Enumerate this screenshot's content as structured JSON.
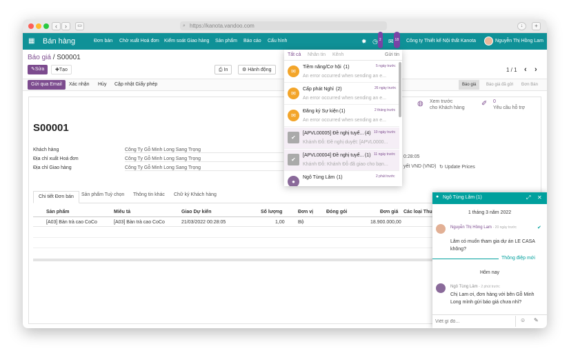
{
  "browser": {
    "url": "https://kanota.vandoo.com"
  },
  "topbar": {
    "app_name": "Bán hàng",
    "menu": [
      "Đơn bán",
      "Chờ xuất Hoá đơn",
      "Kiểm soát Giao hàng",
      "Sản phẩm",
      "Báo cáo",
      "Cấu hình"
    ],
    "activity_count": "2",
    "message_count": "18",
    "company": "Công ty Thiết kế Nội thất Kanota",
    "user": "Nguyễn Thị Hồng Lam"
  },
  "breadcrumb": {
    "parent": "Báo giá",
    "sep": "/",
    "current": "S00001"
  },
  "toolbar": {
    "edit": "Sửa",
    "create": "Tạo",
    "print": "In",
    "action": "Hành động",
    "pager": "1 / 1"
  },
  "statusbar": {
    "buttons": [
      "Gửi qua Email",
      "Xác nhận",
      "Hủy",
      "Cập nhật Giấy phép"
    ],
    "stages": [
      "Báo giá",
      "Báo giá đã gửi",
      "Đơn Bán"
    ]
  },
  "smart": {
    "preview": "Xem trước",
    "preview2": "cho Khách hàng",
    "support_count": "0",
    "support": "Yêu cầu hỗ trợ"
  },
  "order": {
    "name": "S00001",
    "customer_label": "Khách hàng",
    "customer": "Công Ty Gỗ Minh Long Sang Trọng",
    "invoice_label": "Địa chỉ xuất Hoá đơn",
    "invoice": "Công Ty Gỗ Minh Long Sang Trọng",
    "delivery_label": "Địa chỉ Giao hàng",
    "delivery": "Công Ty Gỗ Minh Long Sang Trọng",
    "date_fragment": "0:28:05",
    "pricelist_fragment": "yết VND (VND)",
    "update_prices": "Update Prices"
  },
  "tabs": [
    "Chi tiết Đơn bán",
    "Sản phẩm Tuỳ chọn",
    "Thông tin khác",
    "Chữ ký Khách hàng"
  ],
  "lines": {
    "headers": [
      "Sản phẩm",
      "Miêu tả",
      "Giao Dự kiến",
      "Số lượng",
      "Đơn vị",
      "Đóng gói",
      "Đơn giá",
      "Các loại Thuế"
    ],
    "rows": [
      [
        "[A03] Bàn trà cao CoCo",
        "[A03] Bàn trà cao CoCo",
        "21/03/2022 00:28:05",
        "1,00",
        "Bộ",
        "",
        "18.900.000,00",
        ""
      ]
    ]
  },
  "notifications": {
    "tabs": [
      "Tất cả",
      "Nhân tin",
      "Kênh"
    ],
    "mark_read": "Gửi tin",
    "items": [
      {
        "title": "Tiềm năng/Cơ hội",
        "count": "(1)",
        "time": "5 ngày trước",
        "preview": "An error occurred when sending an e..."
      },
      {
        "title": "Cấp phát Nghỉ",
        "count": "(2)",
        "time": "26 ngày trước",
        "preview": "An error occurred when sending an e..."
      },
      {
        "title": "Đăng ký Sự kiện",
        "count": "(1)",
        "time": "2 tháng trước",
        "preview": "An error occurred when sending an e..."
      },
      {
        "title": "[APVL00005] Đề nghị tuyể...",
        "count": "(4)",
        "time": "10 ngày trước",
        "preview": "Khánh Đỗ: Đề nghị duyệt: [APVL0000..."
      },
      {
        "title": "[APVL00004] Đề nghị tuyể...",
        "count": "(1)",
        "time": "11 ngày trước",
        "preview": "Khánh Đỗ: Khánh Đỗ đã giao cho bạn..."
      },
      {
        "title": "Ngô Tùng Lâm",
        "count": "(1)",
        "time": "2 phút trước",
        "preview": ""
      }
    ]
  },
  "chat": {
    "title": "Ngô Tùng Lâm (1)",
    "date1": "1 tháng 3 năm 2022",
    "m1_author": "Nguyễn Thị Hồng Lam",
    "m1_time": "- 20 ngày trước",
    "m1_text1": "Lâm có muốn tham gia dự án LE CASA",
    "m1_text2": "không?",
    "new_messages": "Thông điệp mới",
    "date2": "Hôm nay",
    "m2_author": "Ngô Tùng Lâm",
    "m2_time": "- 2 phút trước",
    "m2_text1": "Chị Lam ơi, đơn hàng với bên Gỗ Minh",
    "m2_text2": "Long mình gửi báo giá chưa nhỉ?",
    "placeholder": "Viết gì đó..."
  },
  "colors": {
    "brand": "#0f9197",
    "primary": "#7c4b8e",
    "chat_header": "#00a09d"
  }
}
